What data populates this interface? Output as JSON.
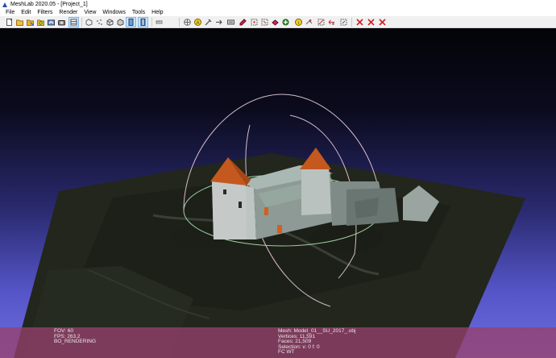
{
  "window": {
    "title": "MeshLab 2020.05 - [Project_1]"
  },
  "menu": [
    "File",
    "Edit",
    "Filters",
    "Render",
    "View",
    "Windows",
    "Tools",
    "Help"
  ],
  "toolbar": {
    "groups": [
      [
        "new-project-icon",
        "open-icon",
        "save-icon",
        "reload-icon",
        "import-icon",
        "snapshot-icon",
        "layers-icon"
      ],
      [
        "bbox-icon",
        "points-icon",
        "wireframe-icon",
        "flat-icon",
        "smooth-icon"
      ],
      [
        "textures-icon"
      ],
      [
        "measure-icon",
        "annotate-icon",
        "align-icon",
        "pick-icon",
        "paint-icon",
        "select-faces-icon",
        "select-vertices-icon",
        "select-connected-icon",
        "zoom-icon",
        "info-icon",
        "manipulator-icon",
        "select-region-icon",
        "paint-selection-icon"
      ],
      [
        "delete-faces-icon",
        "delete-vertices-icon",
        "delete-all-icon"
      ]
    ]
  },
  "viewport": {
    "info_left": {
      "fov": "FOV: 60",
      "fps": "FPS:   263.2",
      "rendering": "BO_RENDERING"
    },
    "info_right": {
      "mesh": "Mesh: Model_01__SU_2017_.obj",
      "vertices": "Vertices: 11,591",
      "faces": "Faces: 21,509",
      "selection": "Selection: v: 0 f: 0",
      "mode": "FC WT"
    }
  }
}
